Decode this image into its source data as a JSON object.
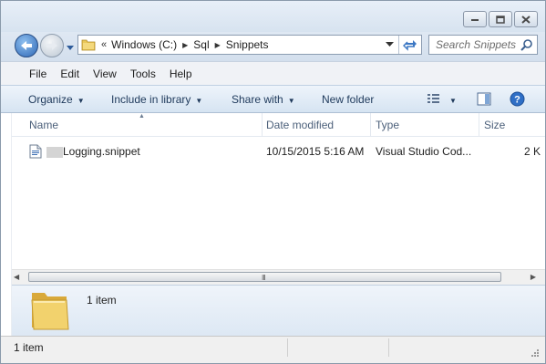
{
  "window": {
    "state_buttons": [
      "minimize",
      "maximize",
      "close"
    ]
  },
  "address": {
    "overflow_label": "«",
    "crumbs": [
      "Windows (C:)",
      "Sql",
      "Snippets"
    ]
  },
  "search": {
    "placeholder": "Search Snippets"
  },
  "menu": [
    "File",
    "Edit",
    "View",
    "Tools",
    "Help"
  ],
  "toolbar": {
    "organize": "Organize",
    "include": "Include in library",
    "share": "Share with",
    "new_folder": "New folder"
  },
  "columns": [
    "Name",
    "Date modified",
    "Type",
    "Size"
  ],
  "files": [
    {
      "name": "Logging.snippet",
      "date": "10/15/2015 5:16 AM",
      "type": "Visual Studio Cod...",
      "size": "2 K"
    }
  ],
  "details_pane": {
    "count": "1 item"
  },
  "status": {
    "text": "1 item"
  },
  "scrollbar": {
    "grip": "III"
  },
  "colors": {
    "accent": "#1e395b",
    "window_frame": "#dde6f1",
    "header_text": "#4c607a"
  },
  "icons": [
    "minimize-icon",
    "maximize-icon",
    "close-icon",
    "back-arrow-icon",
    "forward-arrow-icon",
    "folder-icon",
    "refresh-icon",
    "search-icon",
    "views-icon",
    "preview-pane-icon",
    "help-icon",
    "snippet-file-icon",
    "large-folder-icon",
    "resize-grip-icon"
  ]
}
